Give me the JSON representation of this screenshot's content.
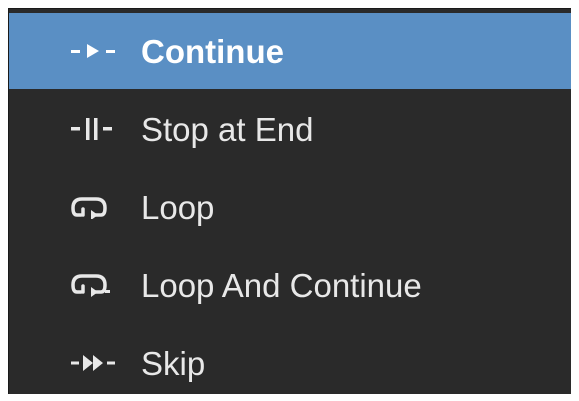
{
  "menu": {
    "items": [
      {
        "label": "Continue",
        "icon": "continue-icon",
        "selected": true
      },
      {
        "label": "Stop at End",
        "icon": "stop-at-end-icon",
        "selected": false
      },
      {
        "label": "Loop",
        "icon": "loop-icon",
        "selected": false
      },
      {
        "label": "Loop And Continue",
        "icon": "loop-and-continue-icon",
        "selected": false
      },
      {
        "label": "Skip",
        "icon": "skip-icon",
        "selected": false
      }
    ]
  },
  "colors": {
    "menu_background": "#2a2a2a",
    "selected_background": "#5a8fc4",
    "text": "#e8e8e8",
    "selected_text": "#ffffff"
  }
}
